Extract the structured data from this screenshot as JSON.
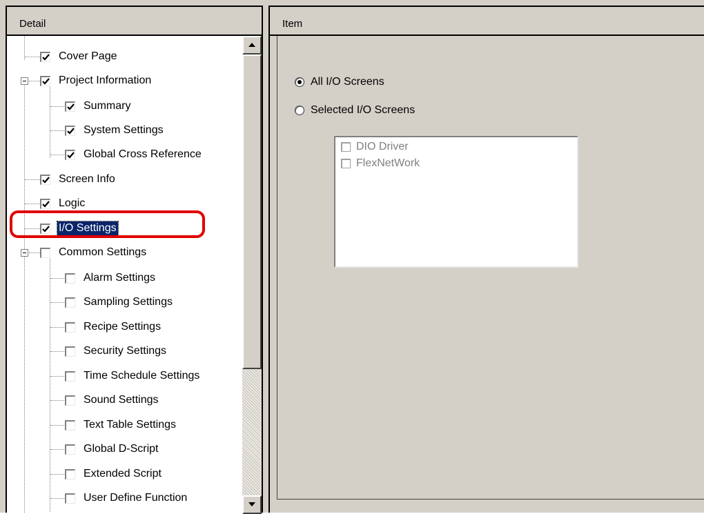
{
  "left_panel": {
    "header": "Detail"
  },
  "right_panel": {
    "header": "Item"
  },
  "tree": {
    "items": [
      {
        "label": "Cover Page",
        "checked": true
      },
      {
        "label": "Project Information",
        "checked": true
      },
      {
        "label": "Summary",
        "checked": true
      },
      {
        "label": "System Settings",
        "checked": true
      },
      {
        "label": "Global Cross Reference",
        "checked": true
      },
      {
        "label": "Screen Info",
        "checked": true
      },
      {
        "label": "Logic",
        "checked": true
      },
      {
        "label": "I/O Settings",
        "checked": true,
        "selected": true
      },
      {
        "label": "Common Settings",
        "checked": false
      },
      {
        "label": "Alarm Settings",
        "checked": false
      },
      {
        "label": "Sampling Settings",
        "checked": false
      },
      {
        "label": "Recipe Settings",
        "checked": false
      },
      {
        "label": "Security Settings",
        "checked": false
      },
      {
        "label": "Time Schedule Settings",
        "checked": false
      },
      {
        "label": "Sound Settings",
        "checked": false
      },
      {
        "label": "Text Table Settings",
        "checked": false
      },
      {
        "label": "Global D-Script",
        "checked": false
      },
      {
        "label": "Extended Script",
        "checked": false
      },
      {
        "label": "User Define Function",
        "checked": false
      }
    ]
  },
  "options": {
    "all_screens": "All I/O Screens",
    "selected_screens": "Selected I/O Screens",
    "selected_option": "all_screens"
  },
  "screen_list": {
    "items": [
      {
        "label": "DIO Driver",
        "checked": false
      },
      {
        "label": "FlexNetWork",
        "checked": false
      }
    ]
  },
  "colors": {
    "highlight_ring": "#e00000",
    "selection": "#0a246a",
    "window_face": "#d4d0c8"
  }
}
